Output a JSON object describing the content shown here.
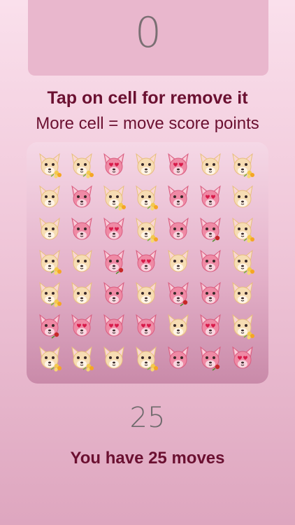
{
  "score": "0",
  "instructions": {
    "line1": "Tap on cell for remove it",
    "line2": "More cell = move score points"
  },
  "moves": {
    "count": "25",
    "label": "You have 25 moves"
  },
  "board": {
    "rows": [
      [
        "cream-dog-flowers",
        "cream-dog-flowers",
        "pink-dog-hearts",
        "cream-dog",
        "pink-dog-hearts",
        "cream-dog",
        "cream-dog-flowers"
      ],
      [
        "cream-dog",
        "pink-dog",
        "cream-dog-flowers",
        "cream-dog-flowers",
        "pink-dog",
        "pink-dog-hearts",
        "cream-dog"
      ],
      [
        "cream-dog",
        "pink-dog",
        "pink-dog-hearts",
        "cream-dog-flowers",
        "pink-dog",
        "pink-dog-rose",
        "cream-dog-flowers"
      ],
      [
        "cream-dog-flowers",
        "cream-dog",
        "pink-dog-rose",
        "pink-dog-hearts",
        "cream-dog",
        "pink-dog",
        "cream-dog-flowers"
      ],
      [
        "cream-dog-flowers",
        "cream-dog",
        "pink-dog",
        "cream-dog",
        "pink-dog-rose",
        "pink-dog",
        "cream-dog"
      ],
      [
        "pink-dog-rose",
        "pink-dog-hearts",
        "pink-dog-hearts",
        "pink-dog-hearts",
        "cream-dog",
        "pink-dog-hearts",
        "cream-dog-flowers"
      ],
      [
        "cream-dog-flowers",
        "cream-dog-flowers",
        "cream-dog",
        "cream-dog-flowers",
        "pink-dog",
        "pink-dog-rose",
        "pink-dog-hearts"
      ]
    ]
  },
  "colors": {
    "title_text": "#6b1031",
    "score_box": "#e9b7cd",
    "dog_pink": "#e86f8e",
    "dog_cream": "#f0cf9c"
  }
}
